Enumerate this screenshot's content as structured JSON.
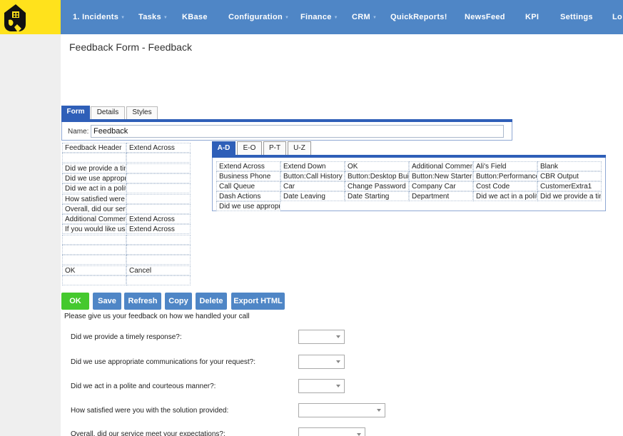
{
  "nav": {
    "items": [
      {
        "label": "1. Incidents",
        "caret": true
      },
      {
        "label": "Tasks",
        "caret": true
      },
      {
        "label": "KBase",
        "caret": false
      },
      {
        "label": "Configuration",
        "caret": true
      },
      {
        "label": "Finance",
        "caret": true
      },
      {
        "label": "CRM",
        "caret": true
      },
      {
        "label": "QuickReports!",
        "caret": false
      },
      {
        "label": "NewsFeed",
        "caret": false
      },
      {
        "label": "KPI",
        "caret": false
      },
      {
        "label": "Settings",
        "caret": false
      },
      {
        "label": "Lo",
        "caret": false
      }
    ],
    "caret_glyph": "▼"
  },
  "page": {
    "title": "Feedback Form - Feedback"
  },
  "tabs": [
    "Form",
    "Details",
    "Styles"
  ],
  "name_field": {
    "label": "Name:",
    "value": "Feedback"
  },
  "layout_grid": {
    "rows": [
      [
        "Feedback  Header",
        "Extend Across"
      ],
      [
        "",
        ""
      ],
      [
        "Did we provide a timely response?",
        ""
      ],
      [
        "Did we use appropriate communications for your request?",
        ""
      ],
      [
        "Did we act in a polite and courteous manner?",
        ""
      ],
      [
        "How satisfied were you with the solution provided?",
        ""
      ],
      [
        "Overall, did our service meet your expectations?",
        ""
      ],
      [
        "Additional Comments",
        "Extend Across"
      ],
      [
        "If you would like us to contact you",
        "Extend Across"
      ],
      [
        "",
        ""
      ],
      [
        "",
        ""
      ],
      [
        "",
        ""
      ],
      [
        "OK",
        "Cancel"
      ],
      [
        "",
        ""
      ]
    ]
  },
  "field_tabs": [
    "A-D",
    "E-O",
    "P-T",
    "U-Z"
  ],
  "field_grid": {
    "rows": [
      [
        "Extend Across",
        "Extend Down",
        "OK",
        "Additional Comments",
        "Ali's Field",
        "Blank"
      ],
      [
        "Business Phone",
        "Button:Call History",
        "Button:Desktop Builder",
        "Button:New Starter",
        "Button:Performance",
        "CBR Output"
      ],
      [
        "Call Queue",
        "Car",
        "Change Password",
        "Company Car",
        "Cost Code",
        "CustomerExtra1"
      ],
      [
        "Dash  Actions",
        "Date Leaving",
        "Date Starting",
        "Department",
        "Did we act in a polite",
        "Did we provide a timely"
      ],
      [
        "Did we use appropriate"
      ]
    ]
  },
  "buttons": [
    "OK",
    "Save",
    "Refresh",
    "Copy",
    "Delete",
    "Export HTML"
  ],
  "preview": {
    "intro": "Please give us your feedback on how we handled your call",
    "questions": [
      {
        "label": "Did we provide a timely response?:",
        "value": ""
      },
      {
        "label": "Did we use appropriate communications for your request?:",
        "value": ""
      },
      {
        "label": "Did we act in a polite and courteous manner?:",
        "value": ""
      },
      {
        "label": "How satisfied were you with the solution provided:",
        "value": ""
      },
      {
        "label": "Overall, did our service meet your expectations?:",
        "value": ""
      }
    ]
  },
  "colors": {
    "nav_bg": "#4f86c6",
    "logo_bg": "#ffe21c",
    "tab_active": "#2f5fb8",
    "ok_button": "#45c92e",
    "button": "#4f86c6"
  },
  "icons": {
    "logo": "house-figure-logo-icon",
    "dropdown": "dropdown-arrow-icon"
  }
}
